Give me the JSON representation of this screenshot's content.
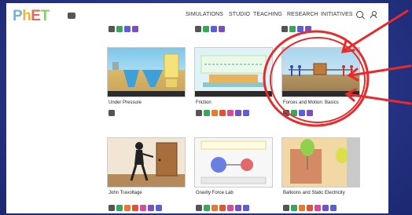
{
  "brand": {
    "logo_letters": [
      "P",
      "h",
      "E",
      "T"
    ]
  },
  "nav": {
    "items": [
      "SIMULATIONS",
      "STUDIO",
      "TEACHING",
      "RESEARCH",
      "INITIATIVES"
    ]
  },
  "cards": [
    {
      "title": "Under Pressure",
      "badge_colors": [
        "#555555"
      ]
    },
    {
      "title": "Friction",
      "badge_colors": [
        "#555555",
        "#3aa55d",
        "#e67a2e",
        "#e0542f",
        "#d84b9a",
        "#7b4fc0",
        "#5a5fd6"
      ]
    },
    {
      "title": "Forces and Motion: Basics",
      "badge_colors": [
        "#555555",
        "#3aa55d",
        "#5a5fd6",
        "#7b4fc0"
      ]
    },
    {
      "title": "John Travoltage",
      "badge_colors": [
        "#555555",
        "#3aa55d",
        "#e67a2e",
        "#e0542f",
        "#d84b9a",
        "#7b4fc0",
        "#5a5fd6"
      ]
    },
    {
      "title": "Gravity Force Lab",
      "badge_colors": [
        "#555555",
        "#3aa55d",
        "#e67a2e",
        "#e0542f",
        "#d84b9a",
        "#7b4fc0",
        "#5a5fd6"
      ]
    },
    {
      "title": "Balloons and Static Electricity",
      "badge_colors": [
        "#555555",
        "#3aa55d",
        "#e67a2e",
        "#e0542f",
        "#d84b9a",
        "#7b4fc0",
        "#5a5fd6"
      ]
    }
  ],
  "colors": {
    "background": "#2a3a8e",
    "annotation": "#e82a2a"
  }
}
